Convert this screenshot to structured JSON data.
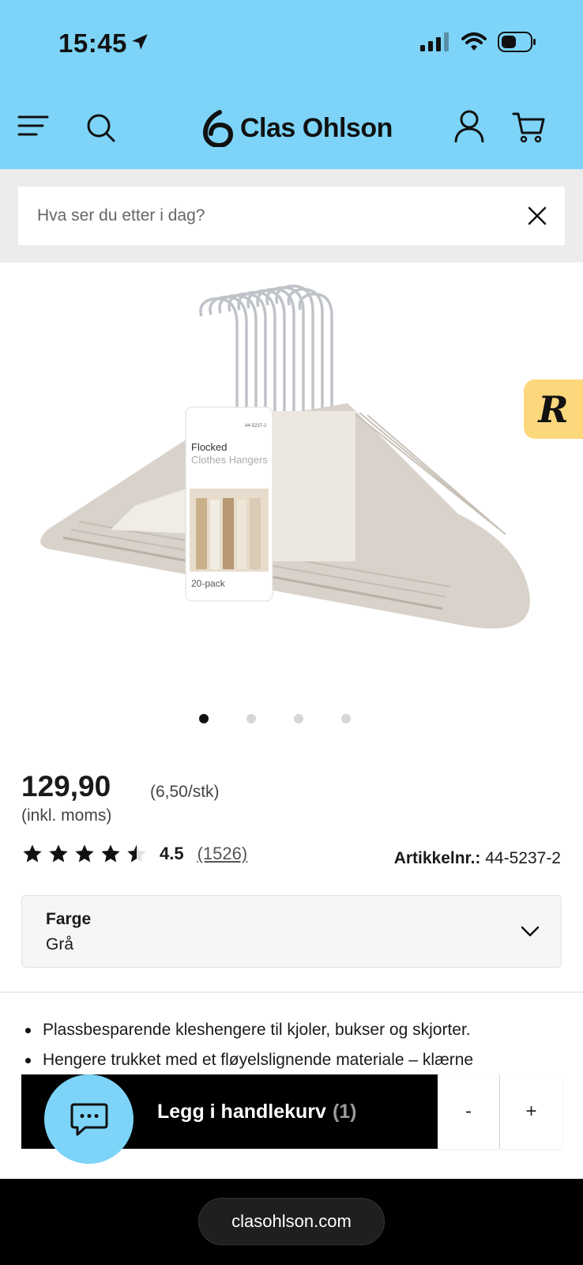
{
  "status_bar": {
    "time": "15:45"
  },
  "header": {
    "brand": "Clas Ohlson",
    "background_color": "#7dd4f8"
  },
  "search": {
    "placeholder": "Hva ser du etter i dag?"
  },
  "gallery": {
    "total_images": 4,
    "active_index": 0,
    "badge_letter": "R",
    "package": {
      "title": "Flocked",
      "subtitle": "Clothes Hangers",
      "pack": "20-pack",
      "article": "44-5237-2"
    }
  },
  "product": {
    "price": "129,90",
    "unit_price": "(6,50/stk)",
    "vat_note": "(inkl. moms)",
    "rating_value": "4.5",
    "rating_stars": 4.5,
    "rating_count": "(1526)",
    "article_label": "Artikkelnr.:",
    "article_number": "44-5237-2",
    "color_label": "Farge",
    "color_value": "Grå",
    "bullets": [
      "Plassbesparende kleshengere til kjoler, bukser og skjorter.",
      "Hengere trukket med et fløyelslignende materiale – klærne"
    ]
  },
  "cart": {
    "add_label": "Legg i handlekurv",
    "quantity_text": "(1)",
    "minus_label": "-",
    "plus_label": "+"
  },
  "browser": {
    "url": "clasohlson.com"
  }
}
